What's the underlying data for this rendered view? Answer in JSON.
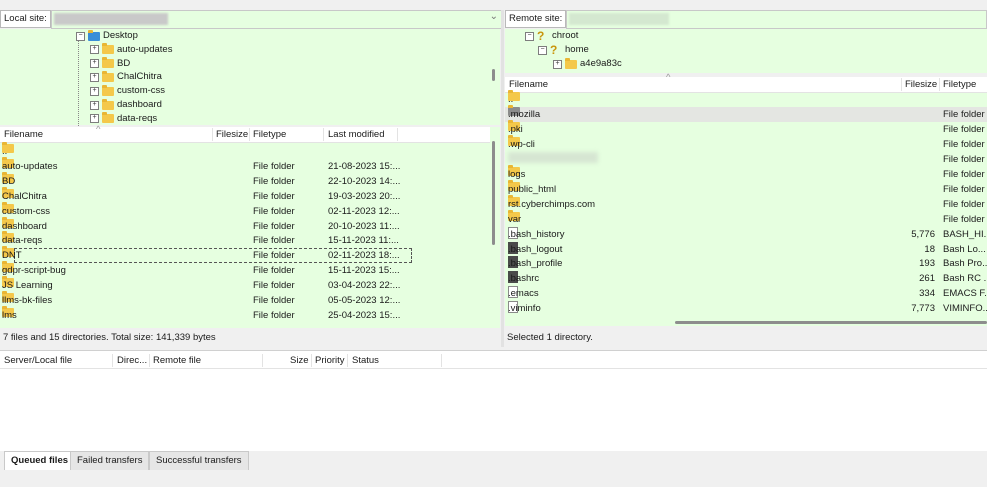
{
  "local": {
    "site_label": "Local site:",
    "dropdown_glyph": "⌄",
    "tree": [
      {
        "label": "Desktop",
        "type": "desktop",
        "expander": "−"
      },
      {
        "label": "auto-updates",
        "type": "folder",
        "expander": "+"
      },
      {
        "label": "BD",
        "type": "folder",
        "expander": "+"
      },
      {
        "label": "ChalChitra",
        "type": "folder",
        "expander": "+"
      },
      {
        "label": "custom-css",
        "type": "folder",
        "expander": "+"
      },
      {
        "label": "dashboard",
        "type": "folder",
        "expander": "+"
      },
      {
        "label": "data-reqs",
        "type": "folder",
        "expander": "+"
      }
    ],
    "columns": {
      "filename": "Filename",
      "filesize": "Filesize",
      "filetype": "Filetype",
      "modified": "Last modified"
    },
    "rows": [
      {
        "name": "..",
        "size": "",
        "type": "",
        "modified": ""
      },
      {
        "name": "auto-updates",
        "size": "",
        "type": "File folder",
        "modified": "21-08-2023 15:..."
      },
      {
        "name": "BD",
        "size": "",
        "type": "File folder",
        "modified": "22-10-2023 14:..."
      },
      {
        "name": "ChalChitra",
        "size": "",
        "type": "File folder",
        "modified": "19-03-2023 20:..."
      },
      {
        "name": "custom-css",
        "size": "",
        "type": "File folder",
        "modified": "02-11-2023 12:..."
      },
      {
        "name": "dashboard",
        "size": "",
        "type": "File folder",
        "modified": "20-10-2023 11:..."
      },
      {
        "name": "data-reqs",
        "size": "",
        "type": "File folder",
        "modified": "15-11-2023 11:..."
      },
      {
        "name": "DNT",
        "size": "",
        "type": "File folder",
        "modified": "02-11-2023 18:..."
      },
      {
        "name": "gdpr-script-bug",
        "size": "",
        "type": "File folder",
        "modified": "15-11-2023 15:..."
      },
      {
        "name": "JS Learning",
        "size": "",
        "type": "File folder",
        "modified": "03-04-2023 22:..."
      },
      {
        "name": "llms-bk-files",
        "size": "",
        "type": "File folder",
        "modified": "05-05-2023 12:..."
      },
      {
        "name": "lms",
        "size": "",
        "type": "File folder",
        "modified": "25-04-2023 15:..."
      }
    ],
    "status": "7 files and 15 directories. Total size: 141,339 bytes"
  },
  "remote": {
    "site_label": "Remote site:",
    "tree": [
      {
        "label": "chroot",
        "type": "unknown",
        "expander": "−"
      },
      {
        "label": "home",
        "type": "unknown",
        "expander": "−"
      },
      {
        "label": "a4e9a83c",
        "type": "folder",
        "expander": "+"
      }
    ],
    "columns": {
      "filename": "Filename",
      "filesize": "Filesize",
      "filetype": "Filetype"
    },
    "rows": [
      {
        "name": "..",
        "size": "",
        "type": "",
        "icon": "folder"
      },
      {
        "name": ".mozilla",
        "size": "",
        "type": "File folder",
        "icon": "folder-dark"
      },
      {
        "name": ".pki",
        "size": "",
        "type": "File folder",
        "icon": "folder"
      },
      {
        "name": ".wp-cli",
        "size": "",
        "type": "File folder",
        "icon": "folder"
      },
      {
        "name": "",
        "size": "",
        "type": "File folder",
        "icon": "none"
      },
      {
        "name": "logs",
        "size": "",
        "type": "File folder",
        "icon": "folder"
      },
      {
        "name": "public_html",
        "size": "",
        "type": "File folder",
        "icon": "folder-link"
      },
      {
        "name": "rst.cyberchimps.com",
        "size": "",
        "type": "File folder",
        "icon": "folder-link"
      },
      {
        "name": "var",
        "size": "",
        "type": "File folder",
        "icon": "folder"
      },
      {
        "name": ".bash_history",
        "size": "5,776",
        "type": "BASH_HI...",
        "icon": "file"
      },
      {
        "name": ".bash_logout",
        "size": "18",
        "type": "Bash Lo...",
        "icon": "file-dark"
      },
      {
        "name": ".bash_profile",
        "size": "193",
        "type": "Bash Pro...",
        "icon": "file-dark"
      },
      {
        "name": ".bashrc",
        "size": "261",
        "type": "Bash RC ...",
        "icon": "file-dark"
      },
      {
        "name": ".emacs",
        "size": "334",
        "type": "EMACS F...",
        "icon": "file"
      },
      {
        "name": ".viminfo",
        "size": "7,773",
        "type": "VIMINFO...",
        "icon": "file"
      }
    ],
    "status": "Selected 1 directory."
  },
  "queue": {
    "columns": {
      "server": "Server/Local file",
      "direction": "Direc...",
      "remote": "Remote file",
      "size": "Size",
      "priority": "Priority",
      "status": "Status"
    },
    "tabs": [
      {
        "label": "Queued files",
        "active": true
      },
      {
        "label": "Failed transfers",
        "active": false
      },
      {
        "label": "Successful transfers",
        "active": false
      }
    ]
  }
}
